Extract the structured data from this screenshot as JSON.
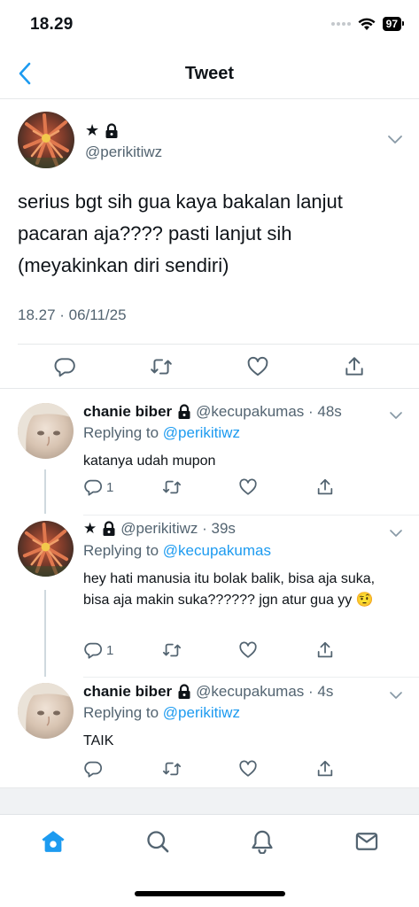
{
  "status_bar": {
    "time": "18.29",
    "battery": "97"
  },
  "nav": {
    "title": "Tweet"
  },
  "main_tweet": {
    "name": "★",
    "handle": "@perikitiwz",
    "text": "serius bgt sih gua kaya bakalan lanjut pacaran aja???? pasti lanjut sih (meyakinkan diri sendiri)",
    "timestamp": "18.27 · 06/11/25"
  },
  "replies": [
    {
      "name": "chanie biber",
      "meta": "@kecupakumas · 48s",
      "replying_label": "Replying to",
      "replying_to": "@perikitiwz",
      "text": "katanya udah mupon",
      "reply_count": "1"
    },
    {
      "name": "★",
      "meta": "@perikitiwz · 39s",
      "replying_label": "Replying to",
      "replying_to": "@kecupakumas",
      "text": "hey hati manusia itu bolak balik, bisa aja suka, bisa aja makin suka?????? jgn atur gua yy 🤨",
      "reply_count": "1"
    },
    {
      "name": "chanie biber",
      "meta": "@kecupakumas · 4s",
      "replying_label": "Replying to",
      "replying_to": "@perikitiwz",
      "text": "TAIK",
      "reply_count": ""
    }
  ],
  "tabs": [
    "home-icon",
    "search-icon",
    "notifications-icon",
    "messages-icon"
  ],
  "colors": {
    "accent": "#1d9bf0",
    "secondary_text": "#536471",
    "primary_text": "#0f1419"
  }
}
